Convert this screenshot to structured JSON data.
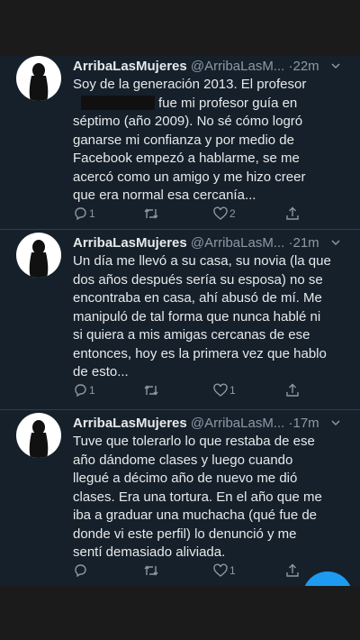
{
  "tweets": [
    {
      "name": "ArribaLasMujeres",
      "handle": "@ArribaLasM...",
      "separator": "·",
      "time": "22m",
      "text": "Soy de la generación 2013. El profesor\n[REDACTED] fue mi profesor guía en\nséptimo (año 2009). No sé cómo logró\nganarse mi confianza y por medio de\nFacebook empezó a hablarme, se me\nacercó como un amigo y me hizo creer\nque era normal esa cercanía...",
      "replies": "1",
      "retweets": "",
      "likes": "2"
    },
    {
      "name": "ArribaLasMujeres",
      "handle": "@ArribaLasM...",
      "separator": "·",
      "time": "21m",
      "text": "Un día me llevó a su casa, su novia (la que\ndos años después sería su esposa) no se\nencontraba en casa, ahí abusó de mí. Me\nmanipuló de tal forma que nunca hablé ni\nsi quiera a mis amigas cercanas de ese\nentonces, hoy es la primera vez que hablo\nde esto...",
      "replies": "1",
      "retweets": "",
      "likes": "1"
    },
    {
      "name": "ArribaLasMujeres",
      "handle": "@ArribaLasM...",
      "separator": "·",
      "time": "17m",
      "text": "Tuve que tolerarlo lo que restaba de ese\naño dándome clases y luego cuando\nllegué a décimo año de nuevo me dió\nclases. Era una tortura. En el año que me\niba a graduar una muchacha (qué fue de\ndonde vi este perfil) lo denunció y me\nsentí demasiado aliviada.",
      "replies": "",
      "retweets": "",
      "likes": "1"
    }
  ],
  "icons": {
    "reply": "reply-icon",
    "retweet": "retweet-icon",
    "like": "heart-icon",
    "share": "share-icon",
    "more": "chevron-down-icon"
  },
  "colors": {
    "background": "#15202b",
    "text": "#e7e9ea",
    "secondary": "#8b98a5",
    "accent": "#1d9bf0"
  }
}
